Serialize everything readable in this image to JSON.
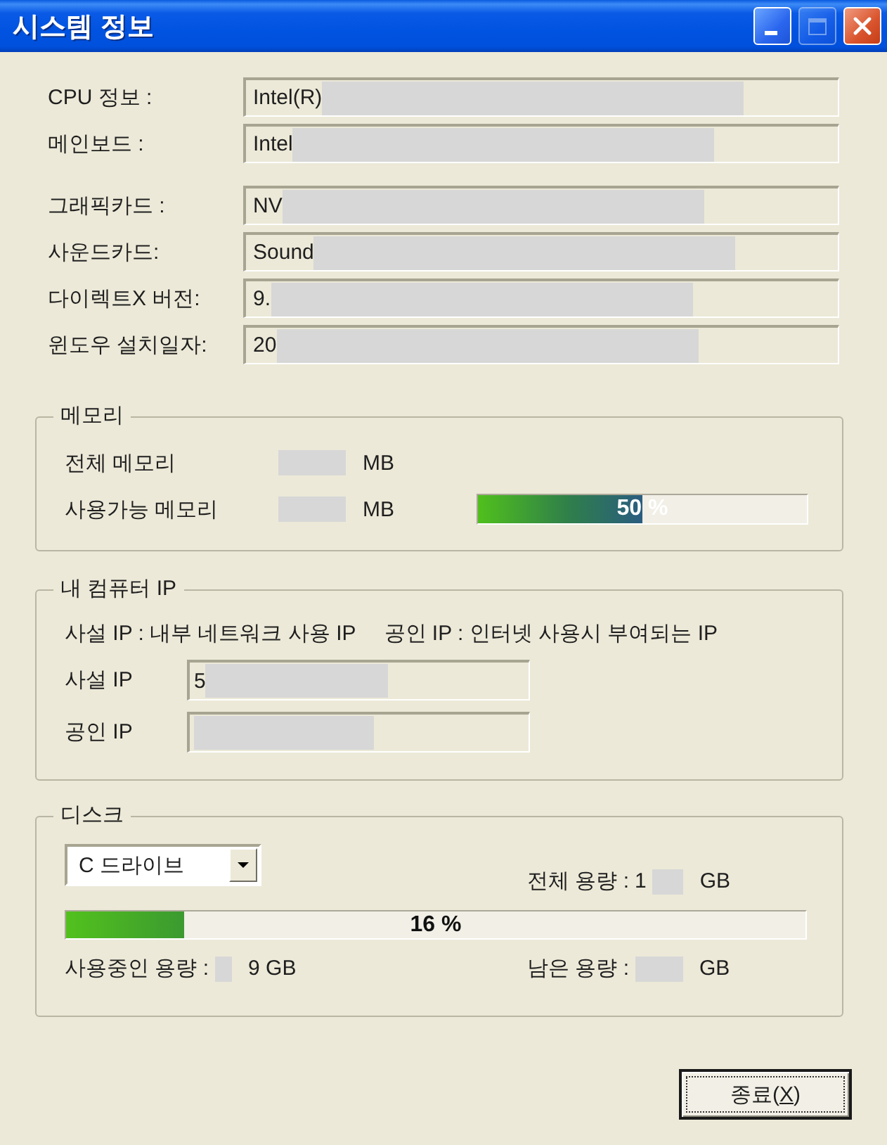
{
  "window": {
    "title": "시스템 정보",
    "controls": [
      {
        "kind": "minimize",
        "disabled": false
      },
      {
        "kind": "maximize",
        "disabled": true
      },
      {
        "kind": "close",
        "disabled": false
      }
    ]
  },
  "info_sections": [
    {
      "fields": [
        {
          "label": "CPU 정보 :",
          "before": "Intel(R)",
          "redacted": true
        },
        {
          "label": "메인보드 :",
          "before": "Intel",
          "redacted": true
        }
      ]
    },
    {
      "fields": [
        {
          "label": "그래픽카드 :",
          "before": "NV",
          "redacted": true
        },
        {
          "label": "사운드카드:",
          "before": "Sound",
          "redacted": true
        },
        {
          "label": "다이렉트X 버전:",
          "before": "9.",
          "redacted": true
        },
        {
          "label": "윈도우 설치일자:",
          "before": "20",
          "redacted": true
        }
      ]
    }
  ],
  "memory": {
    "legend": "메모리",
    "rows": [
      {
        "label": "전체 메모리",
        "redacted": true,
        "after": "MB"
      },
      {
        "label": "사용가능 메모리",
        "redacted": true,
        "after": "MB",
        "bar": {
          "level": 0.5,
          "reading": "50 %"
        }
      }
    ]
  },
  "ip": {
    "legend": "내 컴퓨터 IP",
    "notes": [
      "사설 IP : 내부 네트워크 사용 IP",
      "공인 IP : 인터넷 사용시 부여되는 IP"
    ],
    "fields": [
      {
        "label": "사설 IP",
        "before": "5",
        "redacted": true
      },
      {
        "label": "공인 IP",
        "redacted": true
      }
    ]
  },
  "disk": {
    "legend": "디스크",
    "drive": {
      "value": "C 드라이브"
    },
    "total": {
      "label": "전체 용량 :",
      "before": "1",
      "redacted": true,
      "after": "GB"
    },
    "bar": {
      "level": 0.16,
      "reading": "16 %"
    },
    "used": {
      "label": "사용중인 용량 :",
      "redacted": true,
      "after": "9 GB"
    },
    "free": {
      "label": "남은 용량 :",
      "redacted": true,
      "after": "GB"
    }
  },
  "exit_button": {
    "label": "종료(",
    "access_key": "X",
    "label_end": ")"
  }
}
